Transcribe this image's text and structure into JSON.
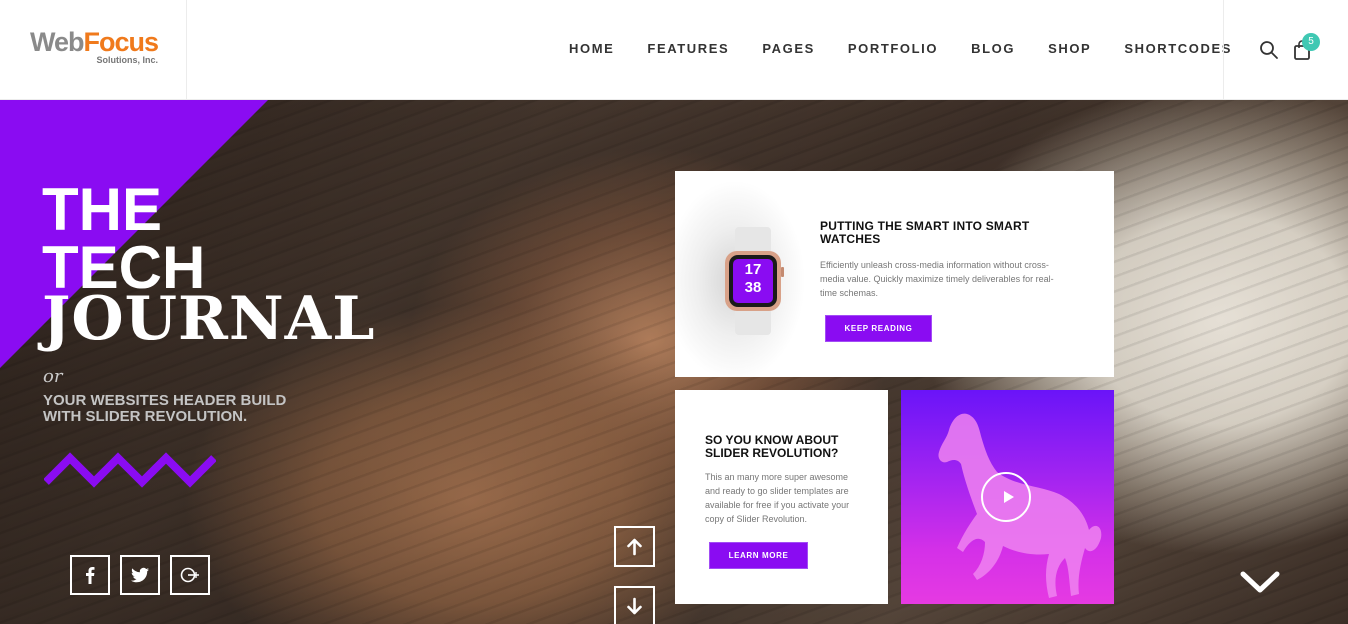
{
  "brand": {
    "name_part1": "Web",
    "name_part2": "Focus",
    "tagline": "Solutions, Inc."
  },
  "nav": {
    "items": [
      "HOME",
      "FEATURES",
      "PAGES",
      "PORTFOLIO",
      "BLOG",
      "SHOP",
      "SHORTCODES"
    ]
  },
  "cart": {
    "count": "5"
  },
  "hero": {
    "title_line1": "THE",
    "title_line2": "TECH",
    "title_line3": "JOURNAL",
    "or": "or",
    "subtitle": "YOUR WEBSITES HEADER BUILD WITH SLIDER REVOLUTION.",
    "accent_color": "#8a0cf2"
  },
  "card_top": {
    "title": "PUTTING THE SMART INTO SMART WATCHES",
    "text": "Efficiently unleash cross-media information without cross-media value. Quickly maximize timely deliverables for real-time schemas.",
    "button": "KEEP READING",
    "watch_hours": "17",
    "watch_minutes": "38"
  },
  "card_bottom_left": {
    "title": "SO YOU KNOW ABOUT SLIDER REVOLUTION?",
    "text": "This an many more super awesome and ready to go slider templates are available for free if you activate your copy of Slider Revolution.",
    "button": "LEARN MORE"
  },
  "icons": [
    "search-icon",
    "shopping-bag-icon",
    "facebook-icon",
    "twitter-icon",
    "google-plus-icon",
    "arrow-up-icon",
    "arrow-down-icon",
    "chevron-down-icon",
    "play-icon"
  ]
}
